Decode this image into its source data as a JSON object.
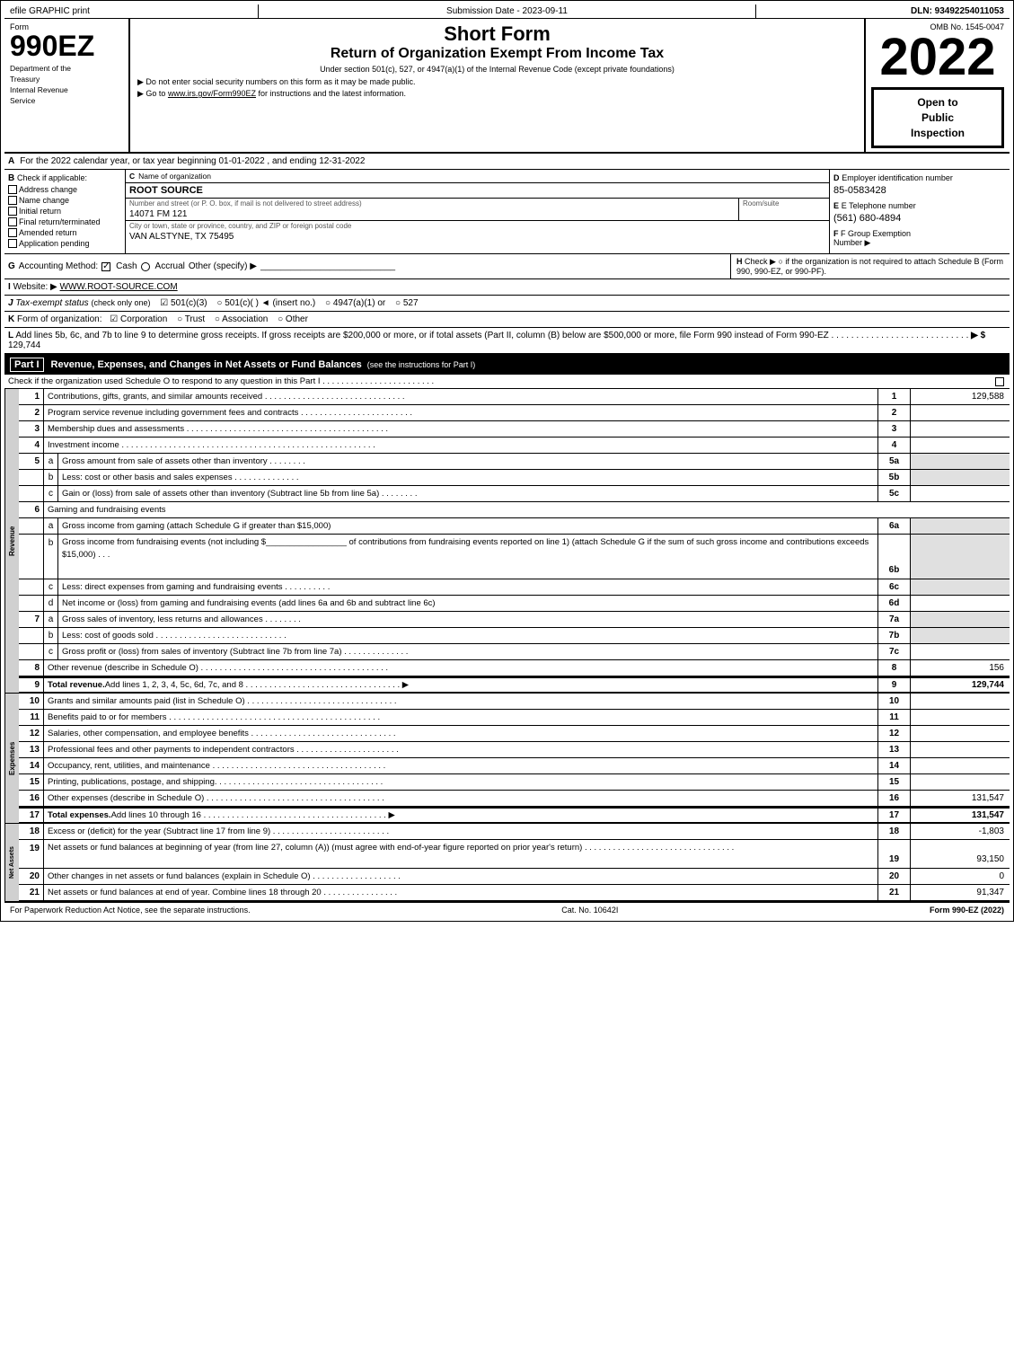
{
  "header": {
    "efile_label": "efile GRAPHIC print",
    "submission_label": "Submission Date - 2023-09-11",
    "dln_label": "DLN: 93492254011053",
    "form_number": "990EZ",
    "form_title": "Short Form",
    "form_subtitle": "Return of Organization Exempt From Income Tax",
    "under_section": "Under section 501(c), 527, or 4947(a)(1) of the Internal Revenue Code (except private foundations)",
    "bullet1": "▶ Do not enter social security numbers on this form as it may be made public.",
    "bullet2": "▶ Go to www.irs.gov/Form990EZ for instructions and the latest information.",
    "omb": "OMB No. 1545-0047",
    "year": "2022",
    "open_public_line1": "Open to",
    "open_public_line2": "Public",
    "open_public_line3": "Inspection",
    "dept_line1": "Department of the",
    "dept_line2": "Treasury",
    "dept_line3": "Internal Revenue",
    "dept_line4": "Service"
  },
  "section_a": {
    "label": "A",
    "text": "For the 2022 calendar year, or tax year beginning 01-01-2022 , and ending 12-31-2022"
  },
  "section_b": {
    "label": "B",
    "title": "Check if applicable:",
    "checkboxes": [
      {
        "id": "address_change",
        "label": "Address change",
        "checked": false
      },
      {
        "id": "name_change",
        "label": "Name change",
        "checked": false
      },
      {
        "id": "initial_return",
        "label": "Initial return",
        "checked": false
      },
      {
        "id": "final_return",
        "label": "Final return/terminated",
        "checked": false
      },
      {
        "id": "amended_return",
        "label": "Amended return",
        "checked": false
      },
      {
        "id": "application_pending",
        "label": "Application pending",
        "checked": false
      }
    ]
  },
  "section_c": {
    "label": "C",
    "name_label": "Name of organization",
    "org_name": "ROOT SOURCE",
    "address_label": "Number and street (or P. O. box, if mail is not delivered to street address)",
    "street": "14071 FM 121",
    "room_label": "Room/suite",
    "room_value": "",
    "city_label": "City or town, state or province, country, and ZIP or foreign postal code",
    "city_value": "VAN ALSTYNE, TX  75495"
  },
  "section_d": {
    "label": "D",
    "ein_label": "Employer identification number",
    "ein_value": "85-0583428",
    "tel_label": "E Telephone number",
    "tel_value": "(561) 680-4894",
    "group_label": "F Group Exemption",
    "group_number_label": "Number",
    "group_arrow": "▶"
  },
  "section_g": {
    "label": "G",
    "accounting_label": "Accounting Method:",
    "cash_label": "Cash",
    "cash_checked": true,
    "accrual_label": "Accrual",
    "accrual_checked": false,
    "other_label": "Other (specify) ▶",
    "other_line": "___________________"
  },
  "section_h": {
    "label": "H",
    "text": "Check ▶  ○ if the organization is not required to attach Schedule B (Form 990, 990-EZ, or 990-PF)."
  },
  "section_i": {
    "label": "I",
    "website_label": "Website: ▶",
    "website_url": "WWW.ROOT-SOURCE.COM"
  },
  "section_j": {
    "label": "J",
    "tax_label": "Tax-exempt status",
    "tax_note": "(check only one)",
    "options": [
      "☑ 501(c)(3)",
      "○ 501(c)(   ) ◄ (insert no.)",
      "○ 4947(a)(1) or",
      "○ 527"
    ]
  },
  "section_k": {
    "label": "K",
    "text": "Form of organization:",
    "options": [
      "☑ Corporation",
      "○ Trust",
      "○ Association",
      "○ Other"
    ]
  },
  "section_l": {
    "label": "L",
    "text": "Add lines 5b, 6c, and 7b to line 9 to determine gross receipts. If gross receipts are $200,000 or more, or if total assets (Part II, column (B) below are $500,000 or more, file Form 990 instead of Form 990-EZ . . . . . . . . . . . . . . . . . . . . . . . . . . . .",
    "arrow": "▶ $",
    "amount": "129,744"
  },
  "part1": {
    "label": "Part I",
    "title": "Revenue, Expenses, and Changes in Net Assets or Fund Balances",
    "see_instructions": "(see the instructions for Part I)",
    "check_text": "Check if the organization used Schedule O to respond to any question in this Part I . . . . . . . . . . . . . . . . . . . . . . . .",
    "rows": [
      {
        "num": "1",
        "sub": "",
        "desc": "Contributions, gifts, grants, and similar amounts received . . . . . . . . . . . . . . . . . . . . . . . . . . . . . .",
        "line_num": "1",
        "value": "129,588",
        "bold_value": false
      },
      {
        "num": "2",
        "sub": "",
        "desc": "Program service revenue including government fees and contracts . . . . . . . . . . . . . . . . . . . . . . . .",
        "line_num": "2",
        "value": "",
        "bold_value": false
      },
      {
        "num": "3",
        "sub": "",
        "desc": "Membership dues and assessments . . . . . . . . . . . . . . . . . . . . . . . . . . . . . . . . . . . . . . . . . . .",
        "line_num": "3",
        "value": "",
        "bold_value": false
      },
      {
        "num": "4",
        "sub": "",
        "desc": "Investment income . . . . . . . . . . . . . . . . . . . . . . . . . . . . . . . . . . . . . . . . . . . . . . . . . . . . . .",
        "line_num": "4",
        "value": "",
        "bold_value": false
      },
      {
        "num": "5",
        "sub": "a",
        "desc": "Gross amount from sale of assets other than inventory . . . . . . . .",
        "line_num": "5a",
        "value": "",
        "bold_value": false,
        "has_sub_box": true
      },
      {
        "num": "",
        "sub": "b",
        "desc": "Less: cost or other basis and sales expenses . . . . . . . . . . . . . .",
        "line_num": "5b",
        "value": "",
        "bold_value": false,
        "has_sub_box": true
      },
      {
        "num": "",
        "sub": "c",
        "desc": "Gain or (loss) from sale of assets other than inventory (Subtract line 5b from line 5a) . . . . . . . .",
        "line_num": "5c",
        "value": "",
        "bold_value": false
      },
      {
        "num": "6",
        "sub": "",
        "desc": "Gaming and fundraising events",
        "line_num": "",
        "value": "",
        "bold_value": false
      },
      {
        "num": "",
        "sub": "a",
        "desc": "Gross income from gaming (attach Schedule G if greater than $15,000)",
        "line_num": "6a",
        "value": "",
        "bold_value": false,
        "has_sub_box": true
      },
      {
        "num": "",
        "sub": "b",
        "desc": "Gross income from fundraising events (not including $_________________ of contributions from fundraising events reported on line 1) (attach Schedule G if the sum of such gross income and contributions exceeds $15,000)  .  .",
        "line_num": "6b",
        "value": "",
        "bold_value": false,
        "has_sub_box": true
      },
      {
        "num": "",
        "sub": "c",
        "desc": "Less: direct expenses from gaming and fundraising events  .  .  .  .",
        "line_num": "6c",
        "value": "",
        "bold_value": false,
        "has_sub_box": true
      },
      {
        "num": "",
        "sub": "d",
        "desc": "Net income or (loss) from gaming and fundraising events (add lines 6a and 6b and subtract line 6c)",
        "line_num": "6d",
        "value": "",
        "bold_value": false
      },
      {
        "num": "7",
        "sub": "a",
        "desc": "Gross sales of inventory, less returns and allowances . . . . . . . .",
        "line_num": "7a",
        "value": "",
        "bold_value": false,
        "has_sub_box": true
      },
      {
        "num": "",
        "sub": "b",
        "desc": "Less: cost of goods sold  .  .  .  .  .  .  .  .  .  .  .  .  .  .  .  .  .  .  .  .  .  .  .  .",
        "line_num": "7b",
        "value": "",
        "bold_value": false,
        "has_sub_box": true
      },
      {
        "num": "",
        "sub": "c",
        "desc": "Gross profit or (loss) from sales of inventory (Subtract line 7b from line 7a) . . . . . . . . . . . . . .",
        "line_num": "7c",
        "value": "",
        "bold_value": false
      },
      {
        "num": "8",
        "sub": "",
        "desc": "Other revenue (describe in Schedule O) . . . . . . . . . . . . . . . . . . . . . . . . . . . . . . . . . . . . . . . .",
        "line_num": "8",
        "value": "156",
        "bold_value": false
      },
      {
        "num": "9",
        "sub": "",
        "desc": "Total revenue. Add lines 1, 2, 3, 4, 5c, 6d, 7c, and 8 . . . . . . . . . . . . . . . . . . . . . . . . . . . . . . .",
        "line_num": "9",
        "value": "129,744",
        "bold_value": true,
        "arrow": true
      }
    ]
  },
  "expenses_rows": [
    {
      "num": "10",
      "desc": "Grants and similar amounts paid (list in Schedule O) . . . . . . . . . . . . . . . . . . . . . . . . . . . . . . . .",
      "line_num": "10",
      "value": ""
    },
    {
      "num": "11",
      "desc": "Benefits paid to or for members  . . . . . . . . . . . . . . . . . . . . . . . . . . . . . . . . . . . . . . . . . . . . .",
      "line_num": "11",
      "value": ""
    },
    {
      "num": "12",
      "desc": "Salaries, other compensation, and employee benefits . . . . . . . . . . . . . . . . . . . . . . . . . . . . . . .",
      "line_num": "12",
      "value": ""
    },
    {
      "num": "13",
      "desc": "Professional fees and other payments to independent contractors . . . . . . . . . . . . . . . . . . . . . .",
      "line_num": "13",
      "value": ""
    },
    {
      "num": "14",
      "desc": "Occupancy, rent, utilities, and maintenance . . . . . . . . . . . . . . . . . . . . . . . . . . . . . . . . . . . . .",
      "line_num": "14",
      "value": ""
    },
    {
      "num": "15",
      "desc": "Printing, publications, postage, and shipping. . . . . . . . . . . . . . . . . . . . . . . . . . . . . . . . . . . .",
      "line_num": "15",
      "value": ""
    },
    {
      "num": "16",
      "desc": "Other expenses (describe in Schedule O) . . . . . . . . . . . . . . . . . . . . . . . . . . . . . . . . . . . . . .",
      "line_num": "16",
      "value": "131,547"
    },
    {
      "num": "17",
      "desc": "Total expenses. Add lines 10 through 16  . . . . . . . . . . . . . . . . . . . . . . . . . . . . . . . . . . . . .",
      "line_num": "17",
      "value": "131,547",
      "bold": true,
      "arrow": true
    }
  ],
  "net_assets_rows": [
    {
      "num": "18",
      "desc": "Excess or (deficit) for the year (Subtract line 17 from line 9) . . . . . . . . . . . . . . . . . . . . . . . . .",
      "line_num": "18",
      "value": "-1,803"
    },
    {
      "num": "19",
      "desc": "Net assets or fund balances at beginning of year (from line 27, column (A)) (must agree with end-of-year figure reported on prior year's return) . . . . . . . . . . . . . . . . . . . . . . . . . . . . . . . .",
      "line_num": "19",
      "value": "93,150"
    },
    {
      "num": "20",
      "desc": "Other changes in net assets or fund balances (explain in Schedule O) . . . . . . . . . . . . . . . . . . .",
      "line_num": "20",
      "value": "0"
    },
    {
      "num": "21",
      "desc": "Net assets or fund balances at end of year. Combine lines 18 through 20 . . . . . . . . . . . . . . . .",
      "line_num": "21",
      "value": "91,347"
    }
  ],
  "footer": {
    "paperwork_text": "For Paperwork Reduction Act Notice, see the separate instructions.",
    "cat_no": "Cat. No. 10642I",
    "form_label": "Form 990-EZ (2022)"
  }
}
